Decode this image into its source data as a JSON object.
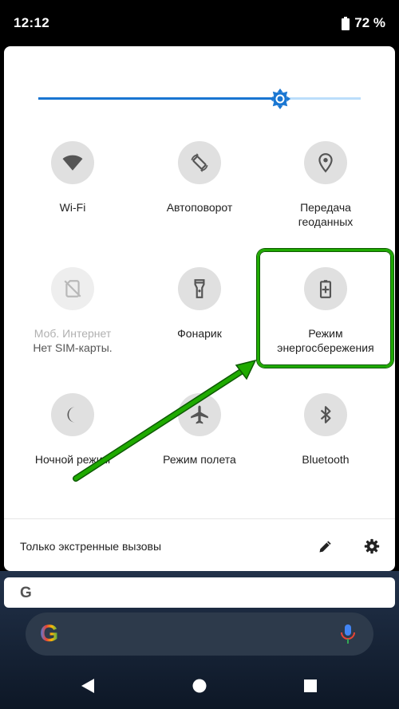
{
  "status_bar": {
    "time": "12:12",
    "battery_percent": "72 %"
  },
  "brightness": {
    "level": 0.75,
    "fill_color": "#1976d2",
    "track_color": "#bbdefb"
  },
  "tiles": [
    {
      "label": "Wi-Fi",
      "sub": "",
      "icon": "wifi-icon",
      "disabled": false
    },
    {
      "label": "Автоповорот",
      "sub": "",
      "icon": "auto-rotate-icon",
      "disabled": false
    },
    {
      "label": "Передача",
      "sub": "геоданных",
      "icon": "location-icon",
      "disabled": false
    },
    {
      "label": "Моб. Интернет",
      "sub": "Нет SIM-карты.",
      "icon": "no-sim-icon",
      "disabled": true
    },
    {
      "label": "Фонарик",
      "sub": "",
      "icon": "flashlight-icon",
      "disabled": false
    },
    {
      "label": "Режим",
      "sub": "энергосбережения",
      "icon": "battery-saver-icon",
      "disabled": false
    },
    {
      "label": "Ночной режим",
      "sub": "",
      "icon": "night-mode-icon",
      "disabled": false
    },
    {
      "label": "Режим полета",
      "sub": "",
      "icon": "airplane-icon",
      "disabled": false
    },
    {
      "label": "Bluetooth",
      "sub": "",
      "icon": "bluetooth-icon",
      "disabled": false
    }
  ],
  "footer": {
    "text": "Только экстренные вызовы",
    "edit_icon": "pencil-icon",
    "settings_icon": "gear-icon"
  },
  "search_strip": {
    "logo_letter": "G"
  },
  "home_search": {
    "logo_letter": "G",
    "mic_icon": "mic-icon"
  },
  "annotation": {
    "color": "#1faa00"
  },
  "nav": {
    "back_icon": "back-icon",
    "home_icon": "home-icon",
    "recents_icon": "recents-icon"
  }
}
